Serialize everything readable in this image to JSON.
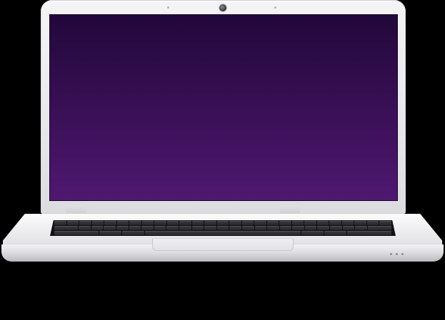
{
  "device": {
    "type": "laptop",
    "color": "#ececef"
  },
  "screen": {
    "gradient_top": "#22073a",
    "gradient_bottom": "#4f1870"
  },
  "background_color": "#000000",
  "icons": [
    "camera-icon",
    "status-led-icon"
  ]
}
